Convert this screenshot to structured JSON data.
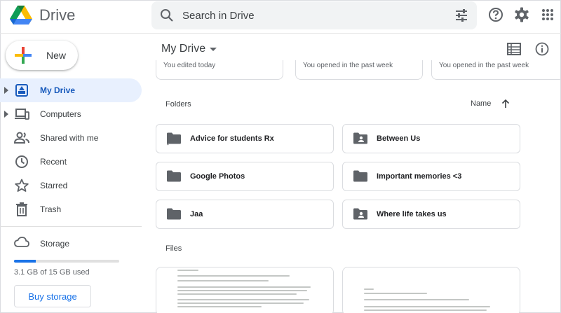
{
  "app": {
    "name": "Drive"
  },
  "search": {
    "placeholder": "Search in Drive"
  },
  "header_icons": [
    "search-icon",
    "tune-icon",
    "help-icon",
    "settings-icon",
    "apps-icon"
  ],
  "sidebar": {
    "new_label": "New",
    "items": [
      {
        "label": "My Drive",
        "icon": "my-drive-icon",
        "active": true,
        "expandable": true
      },
      {
        "label": "Computers",
        "icon": "computers-icon",
        "active": false,
        "expandable": true
      },
      {
        "label": "Shared with me",
        "icon": "shared-icon",
        "active": false,
        "expandable": false
      },
      {
        "label": "Recent",
        "icon": "clock-icon",
        "active": false,
        "expandable": false
      },
      {
        "label": "Starred",
        "icon": "star-icon",
        "active": false,
        "expandable": false
      },
      {
        "label": "Trash",
        "icon": "trash-icon",
        "active": false,
        "expandable": false
      }
    ],
    "storage": {
      "label": "Storage",
      "used_text": "3.1 GB of 15 GB used",
      "used_fraction": 0.207,
      "buy_label": "Buy storage"
    }
  },
  "main": {
    "title": "My Drive",
    "suggested": [
      {
        "caption": "You edited today"
      },
      {
        "caption": "You opened in the past week"
      },
      {
        "caption": "You opened in the past week"
      }
    ],
    "folders_heading": "Folders",
    "sort_label": "Name",
    "folders": [
      {
        "name": "Advice for students Rx",
        "type": "shared-folder"
      },
      {
        "name": "Between Us",
        "type": "shared-folder"
      },
      {
        "name": "Google Photos",
        "type": "folder"
      },
      {
        "name": "Important memories <3",
        "type": "folder"
      },
      {
        "name": "Jaa",
        "type": "folder"
      },
      {
        "name": "Where life takes us",
        "type": "shared-folder"
      }
    ],
    "files_heading": "Files"
  },
  "colors": {
    "accent": "#1a73e8",
    "active_bg": "#e8f0fe",
    "active_text": "#185abc",
    "folder_icon": "#5f6368"
  }
}
